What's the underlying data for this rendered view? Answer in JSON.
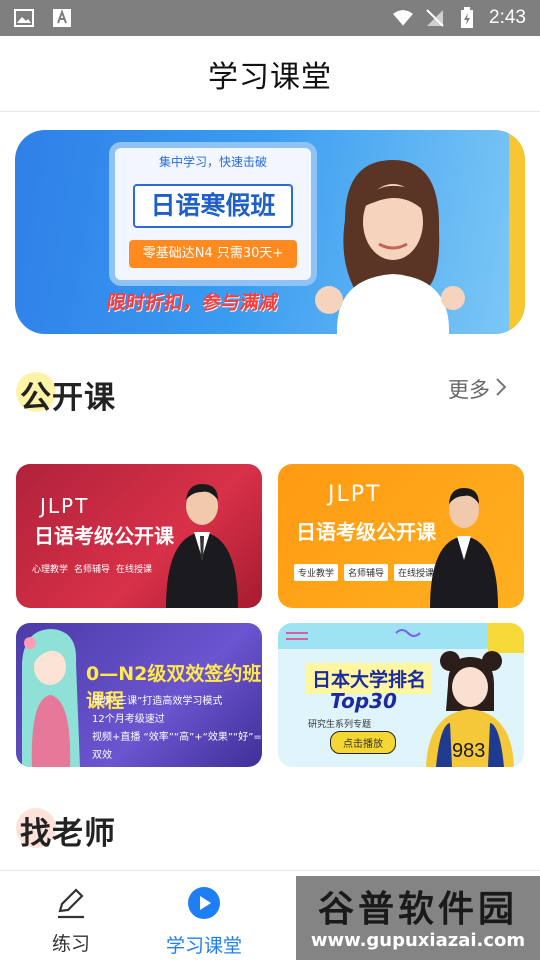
{
  "status": {
    "time": "2:43"
  },
  "header": {
    "title": "学习课堂"
  },
  "banner": {
    "top": "集中学习，快速击破",
    "headline": "日语寒假班",
    "tag": "零基础达N4 只需30天+",
    "slogan": "限时折扣，参与满减"
  },
  "open_course": {
    "title": "公开课",
    "more": "更多"
  },
  "courses": [
    {
      "jlpt": "JLPT",
      "title": "日语考级公开课",
      "tags": [
        "心理教学",
        "名师辅导",
        "在线授课"
      ]
    },
    {
      "jlpt": "JLPT",
      "title": "日语考级公开课",
      "tags": [
        "专业教学",
        "名师辅导",
        "在线授课"
      ]
    },
    {
      "title": "0—N2级双效签约班课程",
      "lines": [
        "同步“三课”打造高效学习模式",
        "12个月考级速过",
        "视频+直播 “效率”“高”+“效果”“好”=双效"
      ]
    },
    {
      "title": "日本大学排名",
      "sub_title": "Top30",
      "sub": "研究生系列专题",
      "button": "点击播放"
    }
  ],
  "find_teacher": {
    "title": "找老师"
  },
  "tabs": [
    {
      "label": "练习",
      "icon": "pencil-icon"
    },
    {
      "label": "学习课堂",
      "icon": "play-circle-icon",
      "active": true
    }
  ],
  "watermark": {
    "text": "谷普软件园",
    "url": "www.gupuxiazai.com"
  },
  "colors": {
    "active": "#1e7ff2",
    "accent_red": "#ff3b3b"
  }
}
